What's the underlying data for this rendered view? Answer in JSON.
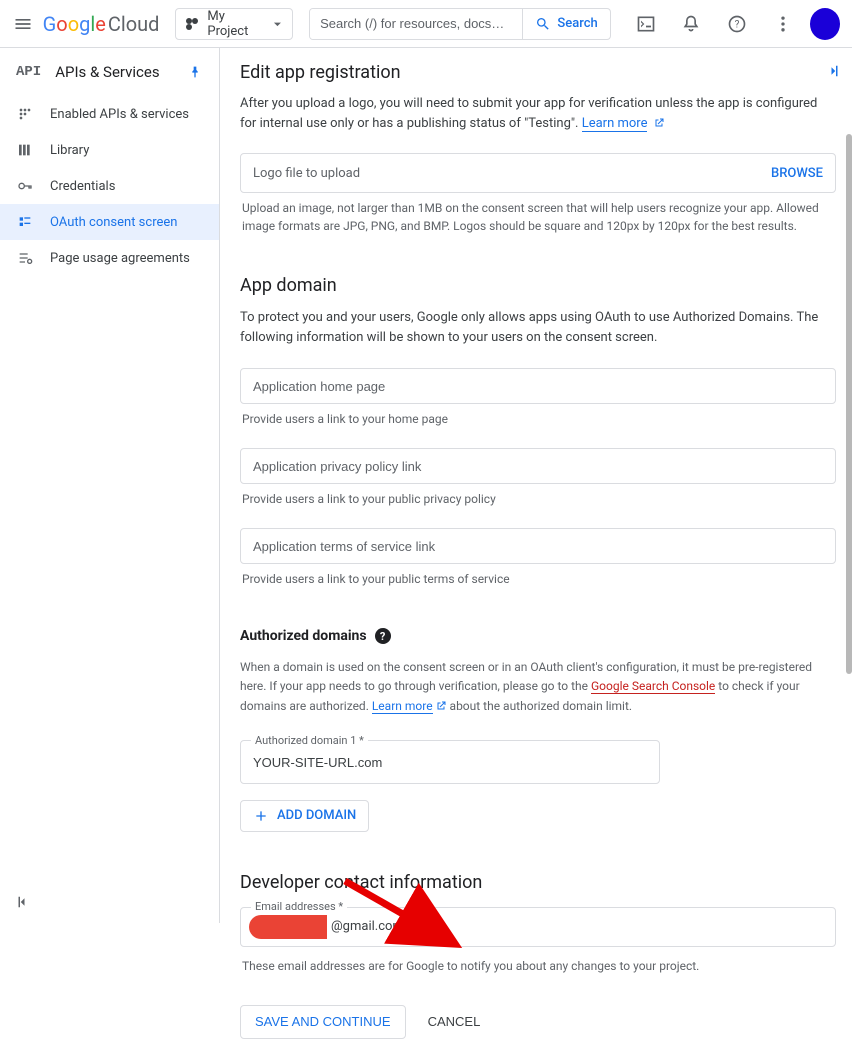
{
  "header": {
    "logo_google": "Google",
    "logo_cloud": "Cloud",
    "project_name": "My Project",
    "search_placeholder": "Search (/) for resources, docs…",
    "search_button": "Search"
  },
  "sidebar": {
    "api_logo": "API",
    "title": "APIs & Services",
    "items": [
      {
        "label": "Enabled APIs & services"
      },
      {
        "label": "Library"
      },
      {
        "label": "Credentials"
      },
      {
        "label": "OAuth consent screen"
      },
      {
        "label": "Page usage agreements"
      }
    ]
  },
  "main": {
    "title": "Edit app registration",
    "logo_section": {
      "pre_text": "After you upload a logo, you will need to submit your app for verification unless the app is configured for internal use only or has a publishing status of \"Testing\". ",
      "learn_more": "Learn more",
      "upload_placeholder": "Logo file to upload",
      "browse": "BROWSE",
      "helper": "Upload an image, not larger than 1MB on the consent screen that will help users recognize your app. Allowed image formats are JPG, PNG, and BMP. Logos should be square and 120px by 120px for the best results."
    },
    "app_domain": {
      "heading": "App domain",
      "desc": "To protect you and your users, Google only allows apps using OAuth to use Authorized Domains. The following information will be shown to your users on the consent screen.",
      "home_ph": "Application home page",
      "home_helper": "Provide users a link to your home page",
      "privacy_ph": "Application privacy policy link",
      "privacy_helper": "Provide users a link to your public privacy policy",
      "tos_ph": "Application terms of service link",
      "tos_helper": "Provide users a link to your public terms of service"
    },
    "auth_domains": {
      "heading": "Authorized domains",
      "para1": "When a domain is used on the consent screen or in an OAuth client's configuration, it must be pre-registered here. If your app needs to go through verification, please go to the ",
      "gsc_link": "Google Search Console",
      "para2": " to check if your domains are authorized. ",
      "learn_more": "Learn more",
      "para3": " about the authorized domain limit.",
      "field_label": "Authorized domain 1 *",
      "field_value": "YOUR-SITE-URL.com",
      "add_button": "ADD DOMAIN"
    },
    "dev_contact": {
      "heading": "Developer contact information",
      "field_label": "Email addresses *",
      "email_suffix": "@gmail.com",
      "helper": "These email addresses are for Google to notify you about any changes to your project."
    },
    "actions": {
      "save": "SAVE AND CONTINUE",
      "cancel": "CANCEL"
    }
  }
}
